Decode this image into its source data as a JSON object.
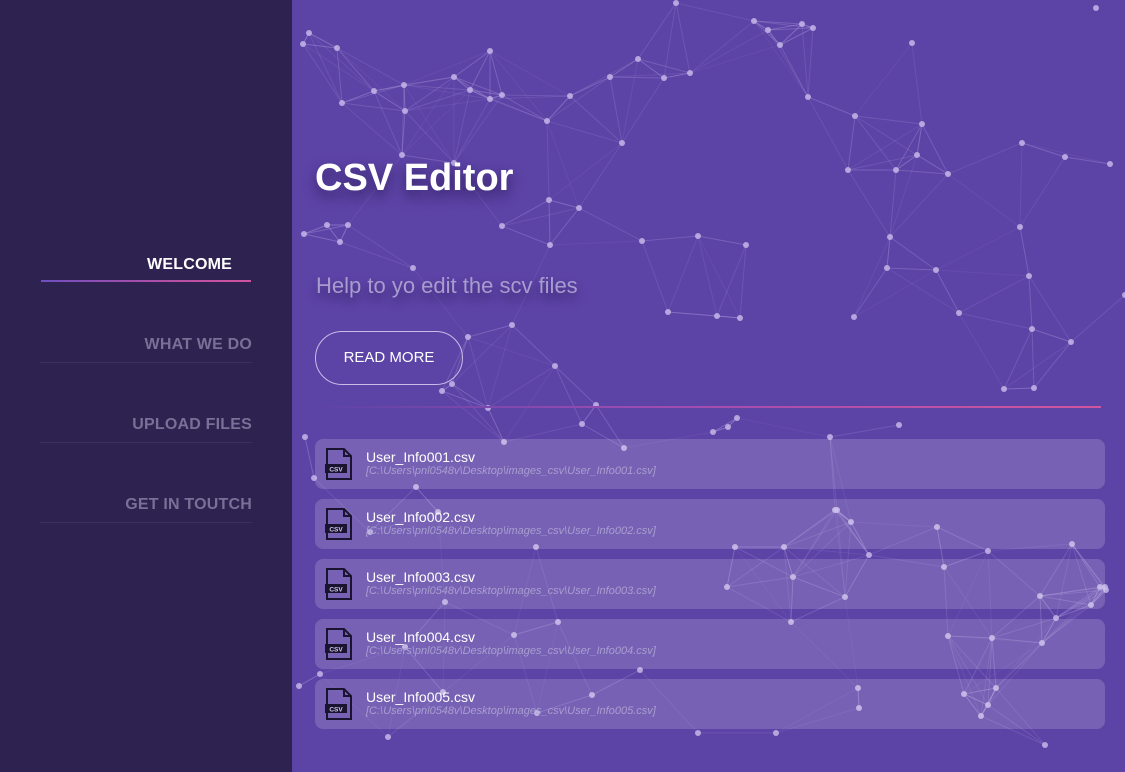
{
  "sidebar": {
    "items": [
      {
        "label": "WELCOME",
        "active": true
      },
      {
        "label": "WHAT WE DO",
        "active": false
      },
      {
        "label": "UPLOAD FILES",
        "active": false
      },
      {
        "label": "GET IN TOUTCH",
        "active": false
      }
    ]
  },
  "hero": {
    "title": "CSV Editor",
    "subtitle": "Help to yo edit the scv files",
    "read_more_label": "READ MORE"
  },
  "file_icon_text": "CSV",
  "files": [
    {
      "name": "User_Info001.csv",
      "path": "[C:\\Users\\pnl0548v\\Desktop\\images_csv\\User_Info001.csv]"
    },
    {
      "name": "User_Info002.csv",
      "path": "[C:\\Users\\pnl0548v\\Desktop\\images_csv\\User_Info002.csv]"
    },
    {
      "name": "User_Info003.csv",
      "path": "[C:\\Users\\pnl0548v\\Desktop\\images_csv\\User_Info003.csv]"
    },
    {
      "name": "User_Info004.csv",
      "path": "[C:\\Users\\pnl0548v\\Desktop\\images_csv\\User_Info004.csv]"
    },
    {
      "name": "User_Info005.csv",
      "path": "[C:\\Users\\pnl0548v\\Desktop\\images_csv\\User_Info005.csv]"
    }
  ],
  "colors": {
    "sidebar_bg": "#2e2250",
    "main_bg": "#5c43a6",
    "accent_pink": "#d0559e",
    "nav_inactive": "#7b6f97"
  },
  "icons": {
    "file": "csv-file-icon",
    "background": "particle-network"
  }
}
